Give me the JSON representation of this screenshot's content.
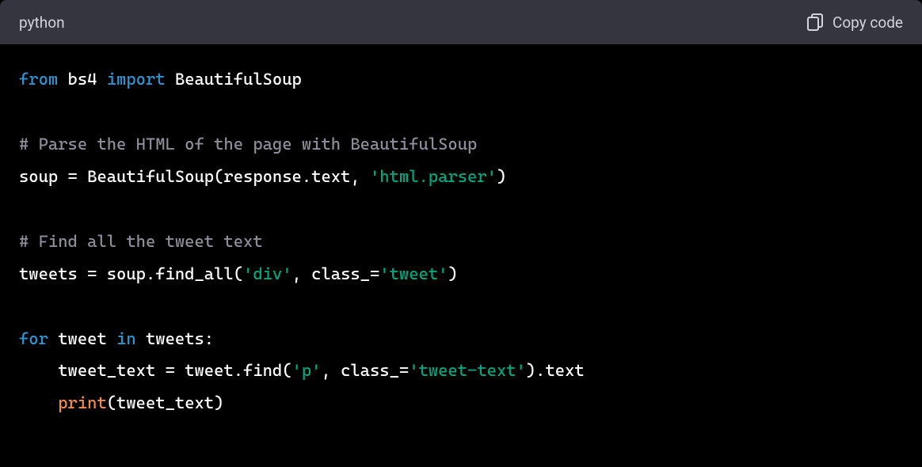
{
  "header": {
    "language": "python",
    "copy_label": "Copy code"
  },
  "code": {
    "line1": {
      "t1": "from",
      "t2": " bs4 ",
      "t3": "import",
      "t4": " BeautifulSoup"
    },
    "line2": "",
    "line3": "# Parse the HTML of the page with BeautifulSoup",
    "line4": {
      "t1": "soup = BeautifulSoup(response.text, ",
      "t2": "'html.parser'",
      "t3": ")"
    },
    "line5": "",
    "line6": "# Find all the tweet text",
    "line7": {
      "t1": "tweets = soup.find_all(",
      "t2": "'div'",
      "t3": ", class_=",
      "t4": "'tweet'",
      "t5": ")"
    },
    "line8": "",
    "line9": {
      "t1": "for",
      "t2": " tweet ",
      "t3": "in",
      "t4": " tweets:"
    },
    "line10": {
      "t1": "    tweet_text = tweet.find(",
      "t2": "'p'",
      "t3": ", class_=",
      "t4": "'tweet-text'",
      "t5": ").text"
    },
    "line11": {
      "t1": "    ",
      "t2": "print",
      "t3": "(tweet_text)"
    }
  }
}
